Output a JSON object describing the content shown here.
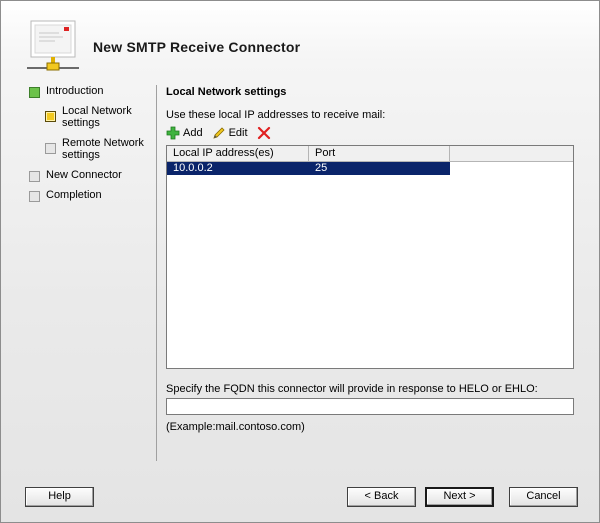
{
  "window": {
    "title": "New SMTP Receive Connector"
  },
  "nav": {
    "items": [
      {
        "label": "Introduction",
        "state": "completed"
      },
      {
        "label": "Local Network settings",
        "line1": "Local Network",
        "line2": "settings",
        "state": "current"
      },
      {
        "label": "Remote Network settings",
        "line1": "Remote Network",
        "line2": "settings",
        "state": "pending"
      },
      {
        "label": "New Connector",
        "state": "pending"
      },
      {
        "label": "Completion",
        "state": "pending"
      }
    ]
  },
  "main": {
    "section_title": "Local Network settings",
    "instruction": "Use these local IP addresses to receive mail:",
    "toolbar": {
      "add": "Add",
      "edit": "Edit"
    },
    "table": {
      "columns": [
        "Local IP address(es)",
        "Port"
      ],
      "rows": [
        {
          "ip": "10.0.0.2",
          "port": "25",
          "selected": true
        }
      ]
    },
    "fqdn_label": "Specify the FQDN this connector will provide in response to HELO or EHLO:",
    "fqdn_value": "",
    "example": "(Example:mail.contoso.com)"
  },
  "buttons": {
    "help": "Help",
    "back": "< Back",
    "next": "Next >",
    "cancel": "Cancel"
  },
  "colors": {
    "selection": "#0a246a",
    "completed": "#6cc24a",
    "current": "#f2c81f"
  }
}
